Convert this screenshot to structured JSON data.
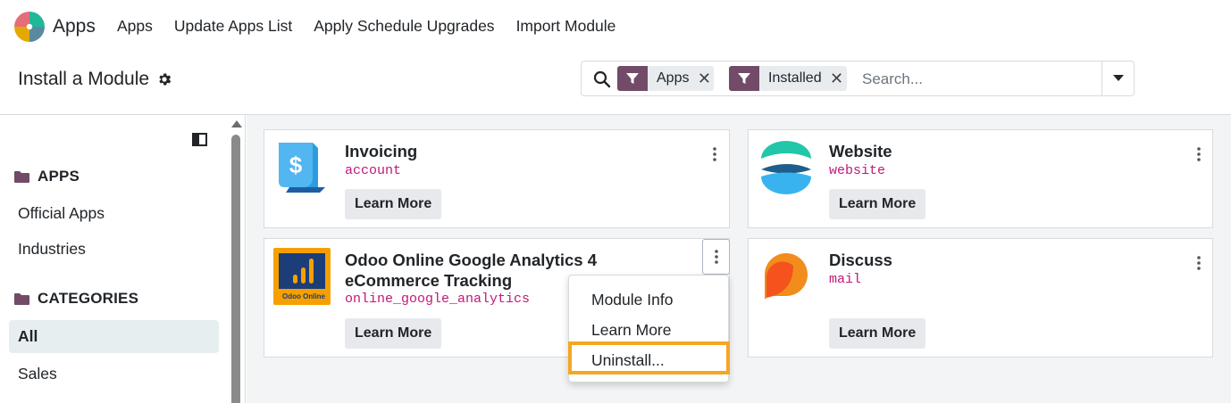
{
  "app": {
    "name": "Apps"
  },
  "menu": [
    "Apps",
    "Update Apps List",
    "Apply Schedule Upgrades",
    "Import Module"
  ],
  "breadcrumb": {
    "title": "Install a Module"
  },
  "search": {
    "facets": [
      {
        "label": "Apps"
      },
      {
        "label": "Installed"
      }
    ],
    "placeholder": "Search..."
  },
  "sidebar": {
    "sections": [
      {
        "label": "APPS",
        "items": [
          "Official Apps",
          "Industries"
        ]
      },
      {
        "label": "CATEGORIES",
        "items": [
          "All",
          "Sales"
        ]
      }
    ],
    "active_item": "All"
  },
  "modules": [
    {
      "title": "Invoicing",
      "technical": "account",
      "button": "Learn More",
      "icon": "invoicing-icon"
    },
    {
      "title": "Website",
      "technical": "website",
      "button": "Learn More",
      "icon": "website-icon"
    },
    {
      "title": "Odoo Online Google Analytics 4 eCommerce Tracking",
      "technical": "online_google_analytics",
      "button": "Learn More",
      "icon": "google-analytics-icon",
      "icon_caption": "Odoo Online"
    },
    {
      "title": "Discuss",
      "technical": "mail",
      "button": "Learn More",
      "icon": "discuss-icon"
    }
  ],
  "dropdown": {
    "items": [
      "Module Info",
      "Learn More",
      "Uninstall..."
    ],
    "highlighted": "Uninstall..."
  },
  "colors": {
    "brand": "#714b67",
    "technical_name": "#c1187a",
    "highlight": "#f5a623",
    "main_bg": "#f3f4f6"
  }
}
